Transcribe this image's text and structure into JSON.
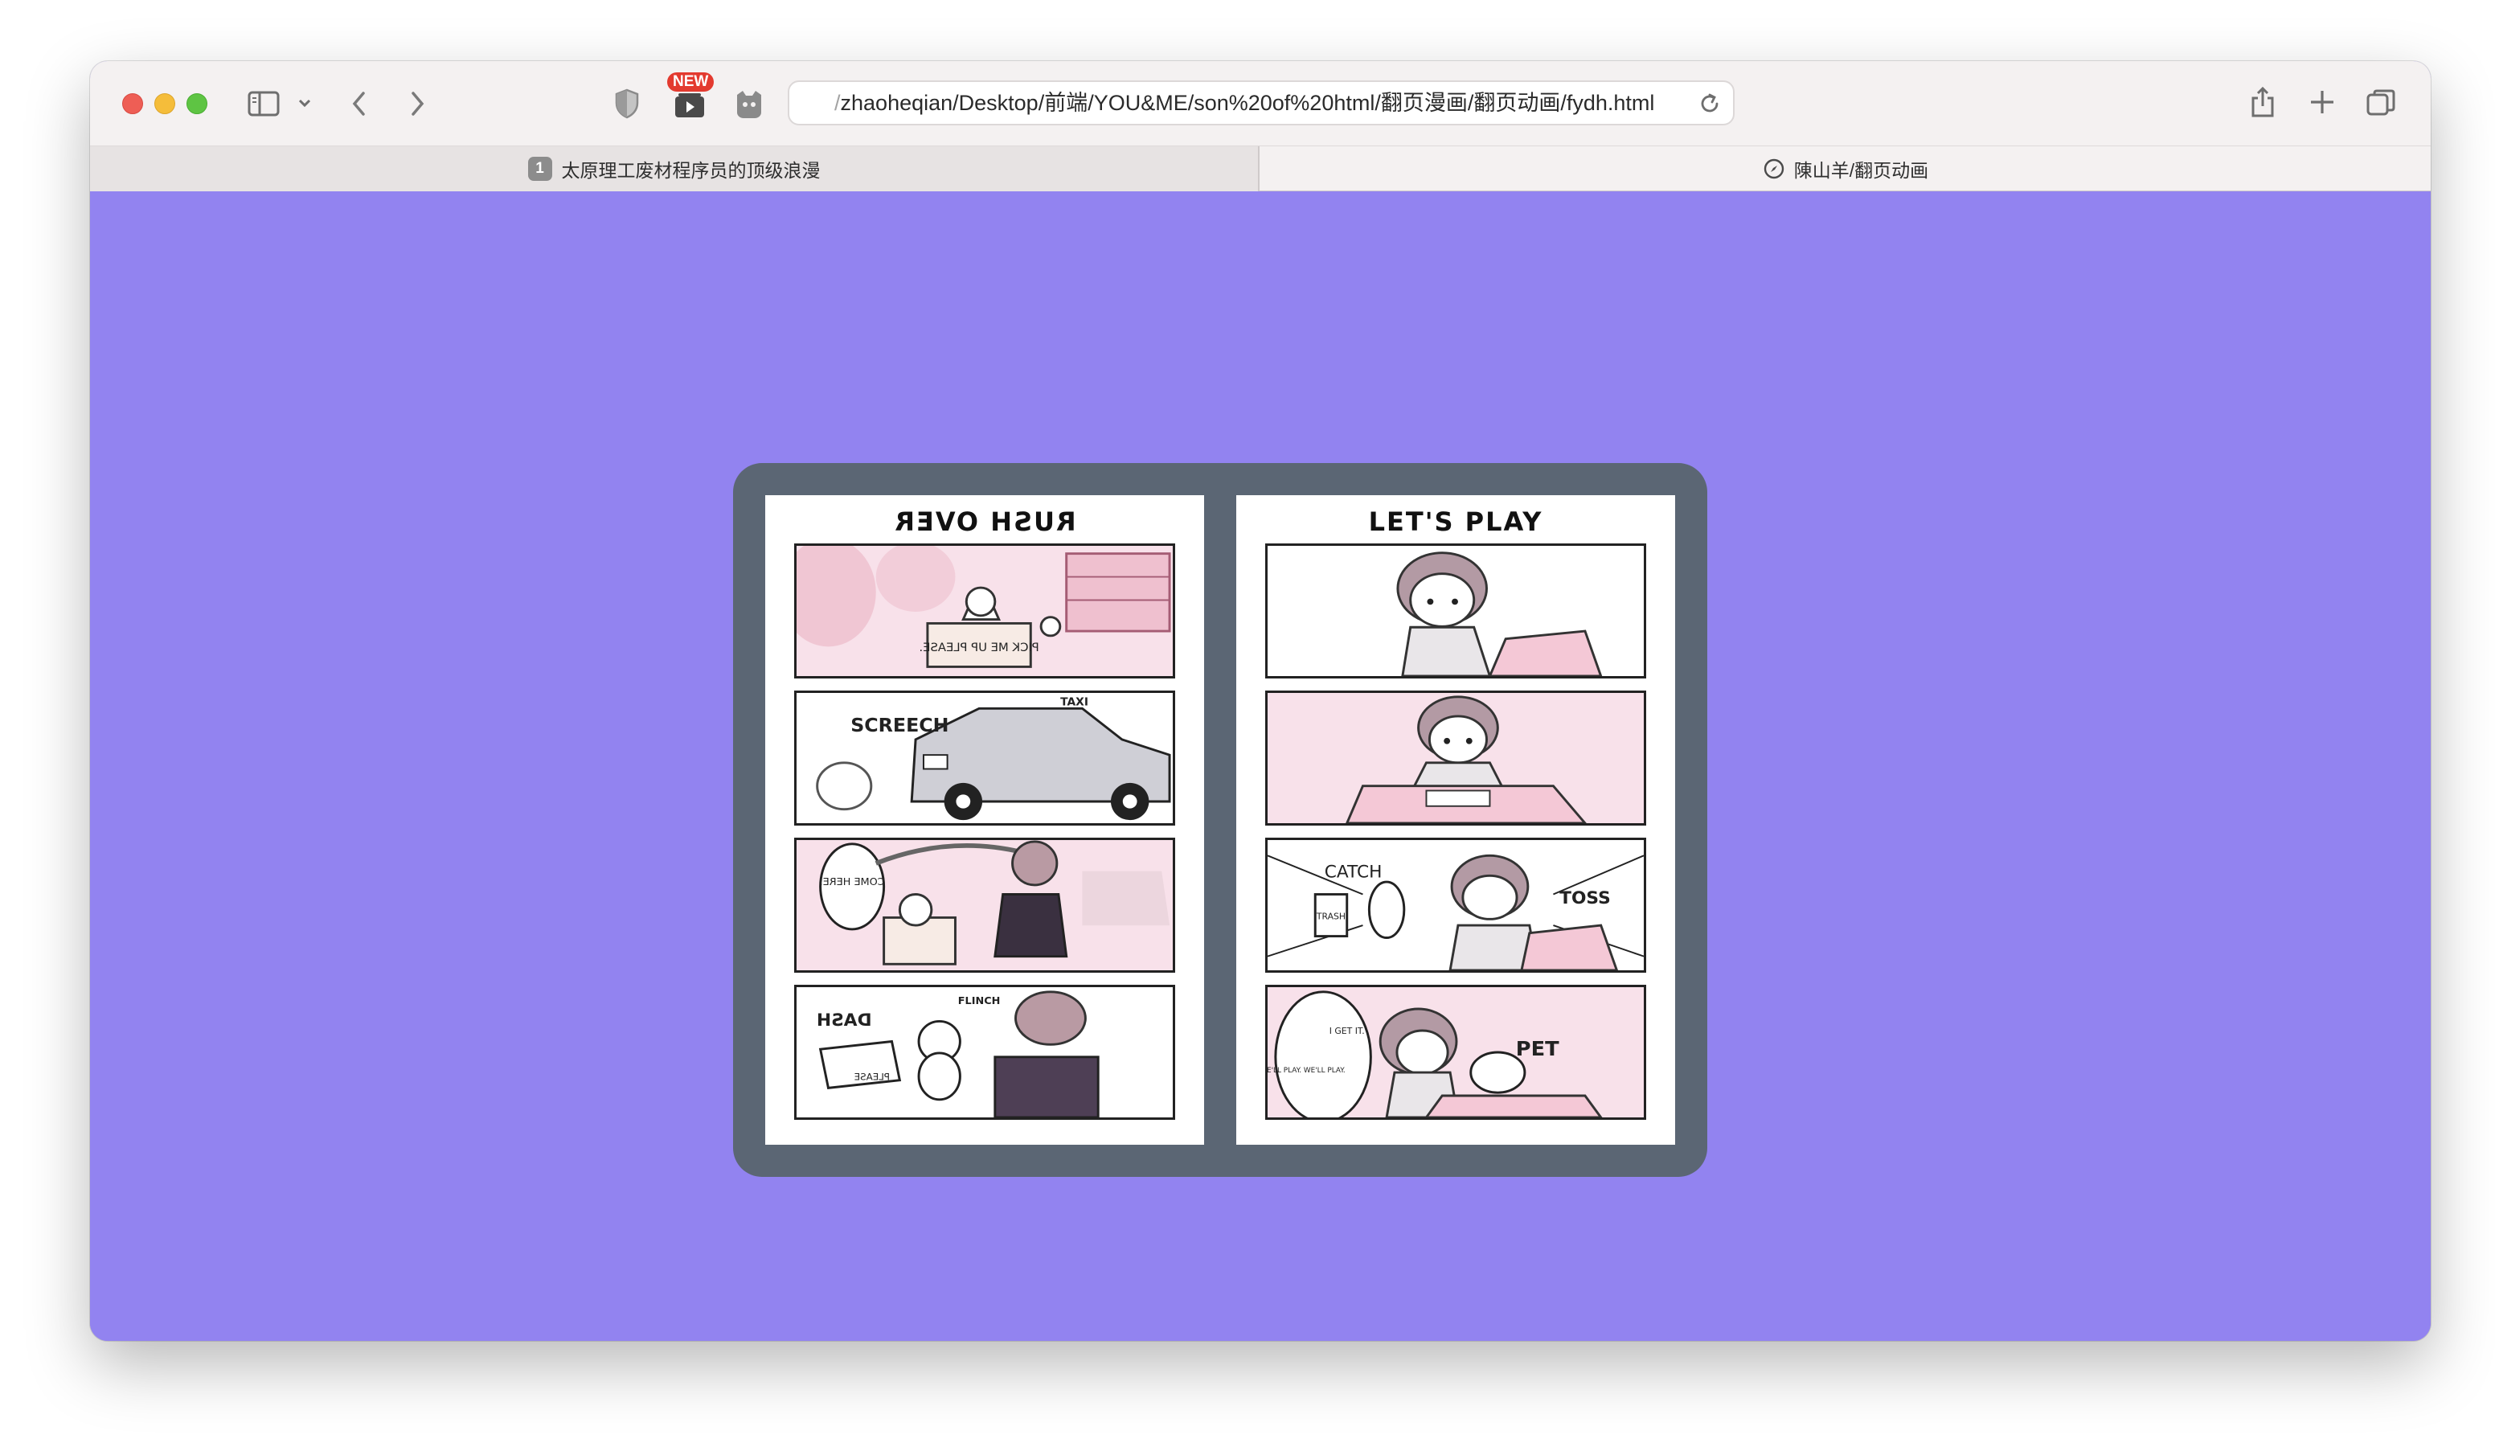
{
  "browser": {
    "badge_new": "NEW",
    "url_prefix": "/",
    "url_main": "zhaoheqian/Desktop/前端/YOU&ME/son%20of%20html/翻页漫画/翻页动画/fydh.html"
  },
  "tabs": [
    {
      "number": "1",
      "label": "太原理工废材程序员的顶级浪漫"
    },
    {
      "label": "陳山羊/翻页动画"
    }
  ],
  "comic": {
    "left_page": {
      "title": "RUSH OVER",
      "panels": [
        {
          "sfx": "PICK ME UP PLEASE."
        },
        {
          "sfx": "SCREECH",
          "sfx2": "TAXI"
        },
        {
          "sfx": "COME HERE."
        },
        {
          "sfx": "DASH",
          "sfx2": "FLINCH",
          "sfx3": "PLEASE"
        }
      ]
    },
    "right_page": {
      "title": "LET'S PLAY",
      "panels": [
        {
          "sfx": ""
        },
        {
          "sfx": ""
        },
        {
          "sfx": "CATCH",
          "sfx2": "TOSS",
          "sfx3": "TRASH"
        },
        {
          "sfx": "PET",
          "sfx2": "I GET IT.",
          "sfx3": "WE'LL PLAY. WE'LL PLAY."
        }
      ]
    }
  },
  "colors": {
    "page_background": "#9283f0",
    "book_frame": "#5b6674",
    "panel_pink": "#f8e1ea",
    "ink": "#222222"
  },
  "icons": [
    "close-icon",
    "minimize-icon",
    "zoom-icon",
    "sidebar-icon",
    "chevron-down-icon",
    "back-icon",
    "forward-icon",
    "shield-icon",
    "media-icon",
    "extension-icon",
    "reload-icon",
    "share-icon",
    "new-tab-icon",
    "tab-overview-icon",
    "compass-icon"
  ]
}
